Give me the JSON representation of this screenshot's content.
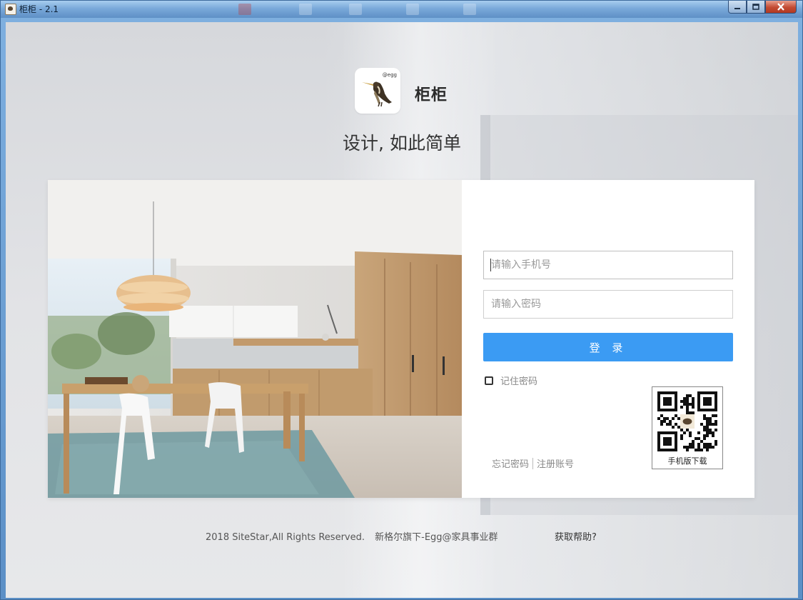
{
  "window": {
    "title": "柜柜 - 2.1",
    "minimize_icon": "minimize-icon",
    "maximize_icon": "maximize-icon",
    "close_icon": "close-icon"
  },
  "brand": {
    "app_name": "柜柜",
    "logo_tag": "@egg",
    "slogan": "设计, 如此简单"
  },
  "login": {
    "phone_placeholder": "请输入手机号",
    "password_placeholder": "请输入密码",
    "submit_label": "登 录",
    "remember_label": "记住密码",
    "forgot_link": "忘记密码",
    "register_link": "注册账号",
    "qr_label": "手机版下载"
  },
  "footer": {
    "copyright": "2018 SiteStar,All Rights Reserved.",
    "company": "新格尔旗下-Egg@家具事业群",
    "help_link": "获取帮助?"
  },
  "colors": {
    "primary_button": "#3b9bf3",
    "title_bar": "#6f9fd0"
  }
}
